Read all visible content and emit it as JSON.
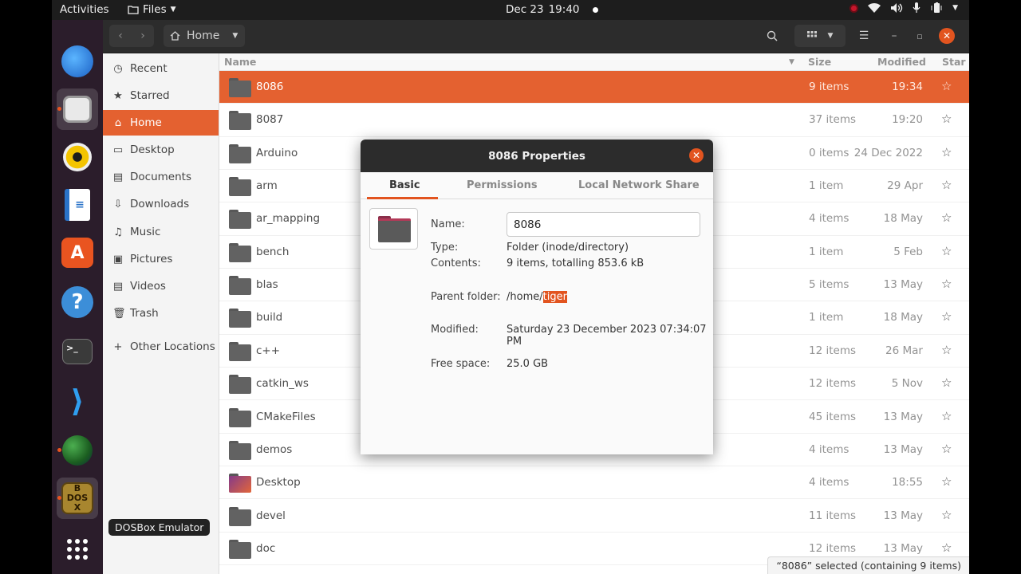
{
  "topbar": {
    "activities": "Activities",
    "app_name": "Files",
    "date": "Dec 23",
    "time": "19:40"
  },
  "dock": {
    "items": [
      "thunderbird-icon",
      "files-icon",
      "rhythmbox-icon",
      "libreoffice-writer-icon",
      "app-center-icon",
      "help-icon",
      "terminal-icon",
      "vscode-icon",
      "globe-icon",
      "dosbox-icon",
      "show-apps-icon"
    ]
  },
  "headerbar": {
    "location": "Home"
  },
  "sidebar": {
    "items": [
      {
        "label": "Recent",
        "icon": "clock-icon"
      },
      {
        "label": "Starred",
        "icon": "star-icon"
      },
      {
        "label": "Home",
        "icon": "home-icon"
      },
      {
        "label": "Desktop",
        "icon": "desktop-icon"
      },
      {
        "label": "Documents",
        "icon": "documents-icon"
      },
      {
        "label": "Downloads",
        "icon": "downloads-icon"
      },
      {
        "label": "Music",
        "icon": "music-icon"
      },
      {
        "label": "Pictures",
        "icon": "pictures-icon"
      },
      {
        "label": "Videos",
        "icon": "videos-icon"
      },
      {
        "label": "Trash",
        "icon": "trash-icon"
      },
      {
        "label": "Other Locations",
        "icon": "plus-icon"
      }
    ]
  },
  "list": {
    "columns": {
      "name": "Name",
      "size": "Size",
      "modified": "Modified",
      "star": "Star"
    },
    "rows": [
      {
        "name": "8086",
        "size": "9 items",
        "modified": "19:34"
      },
      {
        "name": "8087",
        "size": "37 items",
        "modified": "19:20"
      },
      {
        "name": "Arduino",
        "size": "0 items",
        "modified": "24 Dec 2022"
      },
      {
        "name": "arm",
        "size": "1 item",
        "modified": "29 Apr"
      },
      {
        "name": "ar_mapping",
        "size": "4 items",
        "modified": "18 May"
      },
      {
        "name": "bench",
        "size": "1 item",
        "modified": "5 Feb"
      },
      {
        "name": "blas",
        "size": "5 items",
        "modified": "13 May"
      },
      {
        "name": "build",
        "size": "1 item",
        "modified": "18 May"
      },
      {
        "name": "c++",
        "size": "12 items",
        "modified": "26 Mar"
      },
      {
        "name": "catkin_ws",
        "size": "12 items",
        "modified": "5 Nov"
      },
      {
        "name": "CMakeFiles",
        "size": "45 items",
        "modified": "13 May"
      },
      {
        "name": "demos",
        "size": "4 items",
        "modified": "13 May"
      },
      {
        "name": "Desktop",
        "size": "4 items",
        "modified": "18:55"
      },
      {
        "name": "devel",
        "size": "11 items",
        "modified": "13 May"
      },
      {
        "name": "doc",
        "size": "12 items",
        "modified": "13 May"
      }
    ]
  },
  "tooltip": "DOSBox Emulator",
  "status": "“8086” selected  (containing 9 items)",
  "dialog": {
    "title": "8086 Properties",
    "tabs": [
      "Basic",
      "Permissions",
      "Local Network Share"
    ],
    "name_label": "Name:",
    "name_value": "8086",
    "type_label": "Type:",
    "type_value": "Folder (inode/directory)",
    "contents_label": "Contents:",
    "contents_value": "9 items, totalling 853.6 kB",
    "parent_label": "Parent folder:",
    "parent_prefix": "/home/",
    "parent_selected": "tiger",
    "modified_label": "Modified:",
    "modified_value": "Saturday 23 December 2023 07:34:07 PM",
    "free_label": "Free space:",
    "free_value": "25.0 GB"
  }
}
